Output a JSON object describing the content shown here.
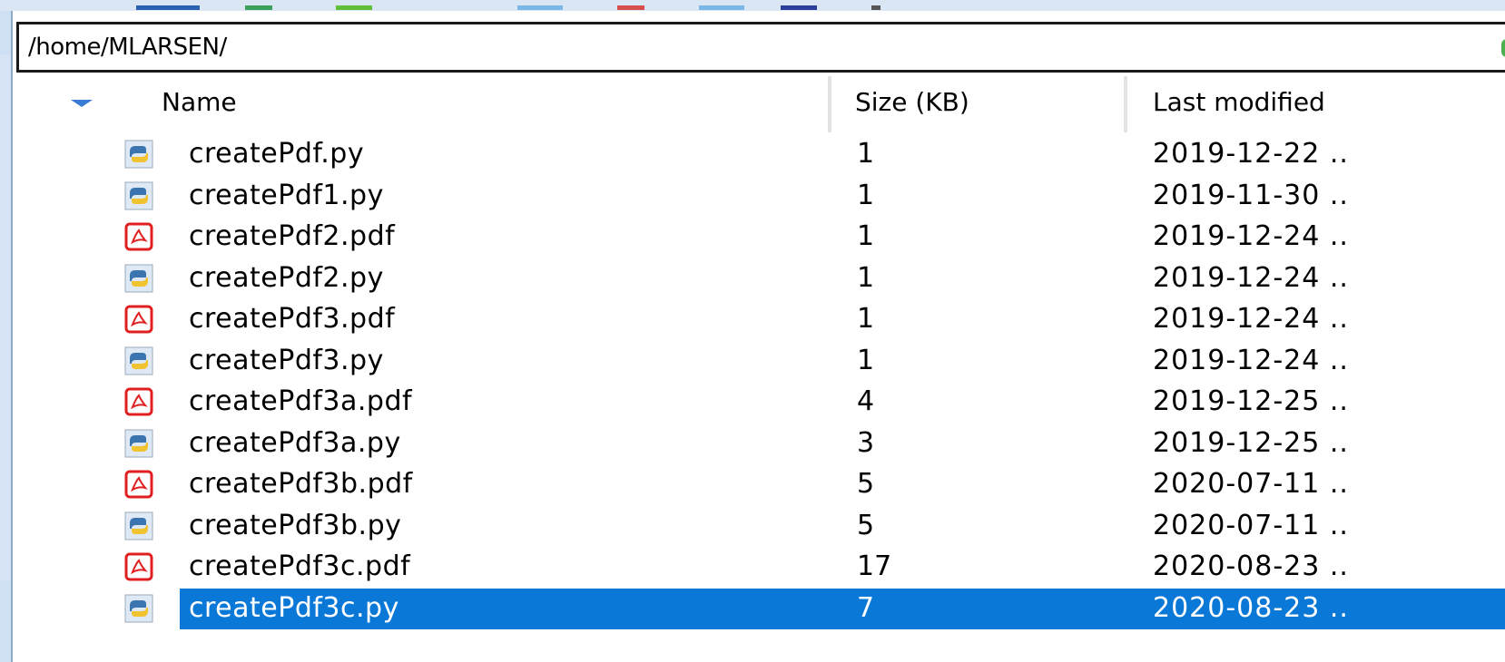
{
  "path_bar": {
    "path": "/home/MLARSEN/"
  },
  "columns": {
    "name": "Name",
    "size": "Size (KB)",
    "modified": "Last modified"
  },
  "files": [
    {
      "name": "createPdf.py",
      "size": "1",
      "modified": "2019-12-22 ..",
      "icon": "python-file-icon"
    },
    {
      "name": "createPdf1.py",
      "size": "1",
      "modified": "2019-11-30 ..",
      "icon": "python-file-icon"
    },
    {
      "name": "createPdf2.pdf",
      "size": "1",
      "modified": "2019-12-24 ..",
      "icon": "pdf-file-icon"
    },
    {
      "name": "createPdf2.py",
      "size": "1",
      "modified": "2019-12-24 ..",
      "icon": "python-file-icon"
    },
    {
      "name": "createPdf3.pdf",
      "size": "1",
      "modified": "2019-12-24 ..",
      "icon": "pdf-file-icon"
    },
    {
      "name": "createPdf3.py",
      "size": "1",
      "modified": "2019-12-24 ..",
      "icon": "python-file-icon"
    },
    {
      "name": "createPdf3a.pdf",
      "size": "4",
      "modified": "2019-12-25 ..",
      "icon": "pdf-file-icon"
    },
    {
      "name": "createPdf3a.py",
      "size": "3",
      "modified": "2019-12-25 ..",
      "icon": "python-file-icon"
    },
    {
      "name": "createPdf3b.pdf",
      "size": "5",
      "modified": "2020-07-11 ..",
      "icon": "pdf-file-icon"
    },
    {
      "name": "createPdf3b.py",
      "size": "5",
      "modified": "2020-07-11 ..",
      "icon": "python-file-icon"
    },
    {
      "name": "createPdf3c.pdf",
      "size": "17",
      "modified": "2020-08-23 ..",
      "icon": "pdf-file-icon"
    },
    {
      "name": "createPdf3c.py",
      "size": "7",
      "modified": "2020-08-23 ..",
      "icon": "python-file-icon",
      "selected": true
    }
  ],
  "colors": {
    "selection": "#0a78d7",
    "pdf_icon": "#e02020",
    "python_blue": "#3a75b0",
    "python_yellow": "#f2c330"
  }
}
